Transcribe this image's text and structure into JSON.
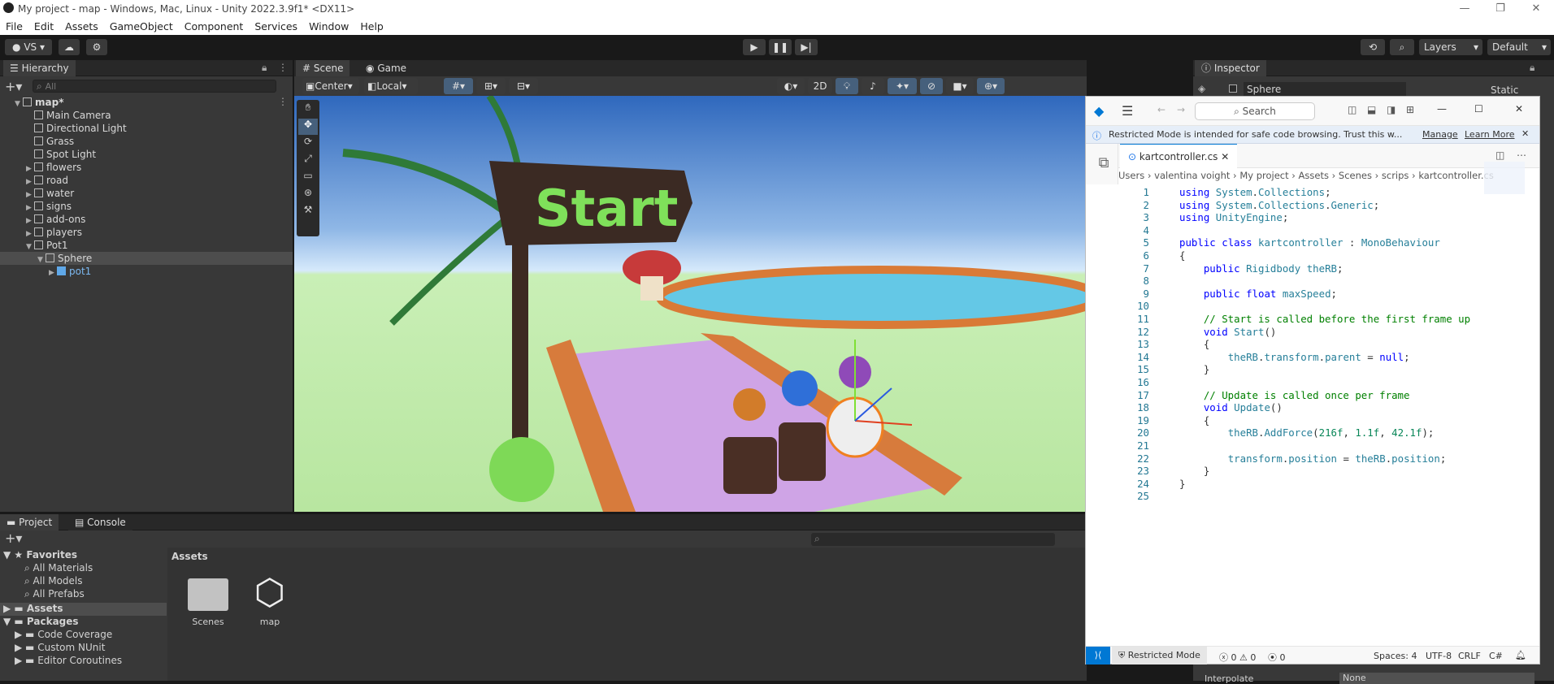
{
  "window": {
    "title": "My project - map - Windows, Mac, Linux - Unity 2022.3.9f1* <DX11>"
  },
  "menu": [
    "File",
    "Edit",
    "Assets",
    "GameObject",
    "Component",
    "Services",
    "Window",
    "Help"
  ],
  "toolbar": {
    "account": "VS",
    "layers": "Layers",
    "layout": "Default"
  },
  "hierarchy": {
    "tab": "Hierarchy",
    "search_placeholder": "All",
    "items": [
      {
        "label": "map*",
        "indent": 0,
        "arrow": "▼",
        "bold": true
      },
      {
        "label": "Main Camera",
        "indent": 1,
        "arrow": ""
      },
      {
        "label": "Directional Light",
        "indent": 1,
        "arrow": ""
      },
      {
        "label": "Grass",
        "indent": 1,
        "arrow": ""
      },
      {
        "label": "Spot Light",
        "indent": 1,
        "arrow": ""
      },
      {
        "label": "flowers",
        "indent": 1,
        "arrow": "▶"
      },
      {
        "label": "road",
        "indent": 1,
        "arrow": "▶"
      },
      {
        "label": "water",
        "indent": 1,
        "arrow": "▶"
      },
      {
        "label": "signs",
        "indent": 1,
        "arrow": "▶"
      },
      {
        "label": "add-ons",
        "indent": 1,
        "arrow": "▶"
      },
      {
        "label": "players",
        "indent": 1,
        "arrow": "▶"
      },
      {
        "label": "Pot1",
        "indent": 1,
        "arrow": "▼"
      },
      {
        "label": "Sphere",
        "indent": 2,
        "arrow": "▼",
        "selected": true
      },
      {
        "label": "pot1",
        "indent": 3,
        "arrow": "▶",
        "prefab": true
      }
    ]
  },
  "scene": {
    "tabs": [
      "Scene",
      "Game"
    ],
    "pivot": "Center",
    "space": "Local",
    "mode2d": "2D",
    "sign_text": "Start"
  },
  "project": {
    "tabs": [
      "Project",
      "Console"
    ],
    "favorites_label": "Favorites",
    "favorites": [
      "All Materials",
      "All Models",
      "All Prefabs"
    ],
    "assets_label": "Assets",
    "packages_label": "Packages",
    "packages": [
      "Code Coverage",
      "Custom NUnit",
      "Editor Coroutines"
    ],
    "breadcrumb": "Assets",
    "grid": [
      {
        "label": "Scenes",
        "kind": "folder"
      },
      {
        "label": "map",
        "kind": "unity"
      }
    ]
  },
  "inspector": {
    "tab": "Inspector",
    "object": "Sphere",
    "static_label": "Static",
    "interpolate_label": "Interpolate",
    "interpolate_value": "None"
  },
  "vscode": {
    "search": "Search",
    "banner": "Restricted Mode is intended for safe code browsing. Trust this w...",
    "banner_manage": "Manage",
    "banner_learn": "Learn More",
    "tab": "kartcontroller.cs",
    "breadcrumb": [
      "Users",
      "valentina voight",
      "My project",
      "Assets",
      "Scenes",
      "scrips",
      "kartcontroller.cs"
    ],
    "lines": [
      "using System.Collections;",
      "using System.Collections.Generic;",
      "using UnityEngine;",
      "",
      "public class kartcontroller : MonoBehaviour",
      "{",
      "    public Rigidbody theRB;",
      "",
      "    public float maxSpeed;",
      "",
      "    // Start is called before the first frame up",
      "    void Start()",
      "    {",
      "        theRB.transform.parent = null;",
      "    }",
      "",
      "    // Update is called once per frame",
      "    void Update()",
      "    {",
      "        theRB.AddForce(216f, 1.1f, 42.1f);",
      "",
      "        transform.position = theRB.position;",
      "    }",
      "}",
      ""
    ],
    "status": {
      "mode": "Restricted Mode",
      "errors": "0",
      "warnings": "0",
      "ports": "0",
      "spaces": "Spaces: 4",
      "encoding": "UTF-8",
      "eol": "CRLF",
      "lang": "C#"
    }
  }
}
